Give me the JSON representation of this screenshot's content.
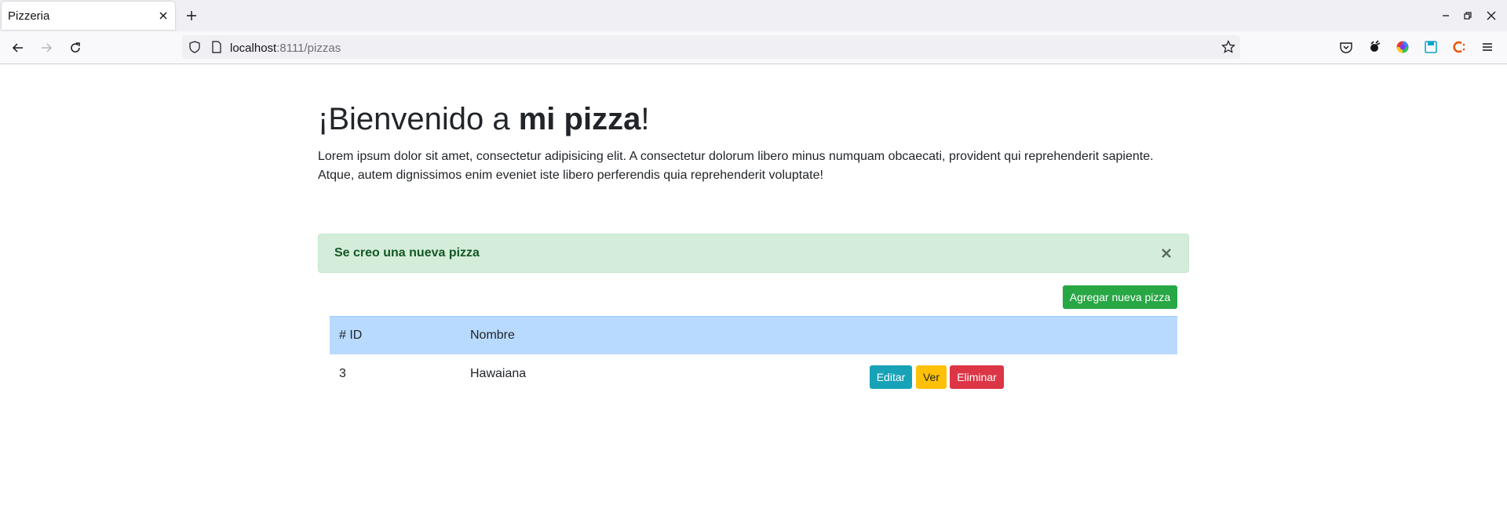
{
  "browser": {
    "tab_title": "Pizzeria",
    "url_host": "localhost",
    "url_rest": ":8111/pizzas",
    "icons": [
      "close-icon",
      "plus-icon",
      "minimize-icon",
      "restore-icon",
      "window-close-icon",
      "back-arrow-icon",
      "forward-arrow-icon",
      "reload-icon",
      "shield-icon",
      "page-icon",
      "bookmark-star-icon",
      "pocket-icon",
      "extension-icon",
      "color-wheel-icon",
      "save-icon",
      "extension-c-icon",
      "menu-icon"
    ]
  },
  "page": {
    "title_prefix": "¡Bienvenido a ",
    "title_bold": "mi pizza",
    "title_suffix": "!",
    "intro": "Lorem ipsum dolor sit amet, consectetur adipisicing elit. A consectetur dolorum libero minus numquam obcaecati, provident qui reprehenderit sapiente. Atque, autem dignissimos enim eveniet iste libero perferendis quia reprehenderit voluptate!"
  },
  "alert": {
    "message": "Se creo una nueva pizza",
    "close_symbol": "×"
  },
  "actions": {
    "add_label": "Agregar nueva pizza"
  },
  "table": {
    "headers": [
      "# ID",
      "Nombre"
    ],
    "rows": [
      {
        "id": "3",
        "name": "Hawaiana",
        "edit_label": "Editar",
        "view_label": "Ver",
        "delete_label": "Eliminar"
      }
    ]
  },
  "colors": {
    "alert_bg": "#d4edda",
    "alert_text": "#155724",
    "success": "#28a745",
    "info": "#17a2b8",
    "warning": "#ffc107",
    "danger": "#dc3545",
    "table_head": "#b8daff"
  }
}
